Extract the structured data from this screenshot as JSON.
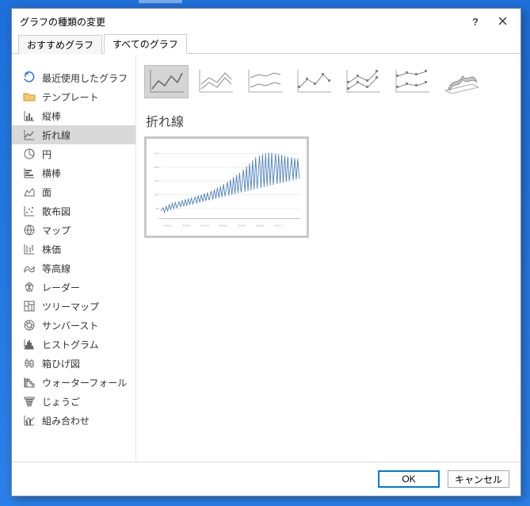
{
  "dialog": {
    "title": "グラフの種類の変更",
    "help_label": "?",
    "tabs": {
      "recommended": "おすすめグラフ",
      "all": "すべてのグラフ"
    }
  },
  "categories": [
    {
      "id": "recent",
      "label": "最近使用したグラフ"
    },
    {
      "id": "templates",
      "label": "テンプレート"
    },
    {
      "id": "column",
      "label": "縦棒"
    },
    {
      "id": "line",
      "label": "折れ線"
    },
    {
      "id": "pie",
      "label": "円"
    },
    {
      "id": "bar",
      "label": "横棒"
    },
    {
      "id": "area",
      "label": "面"
    },
    {
      "id": "scatter",
      "label": "散布図"
    },
    {
      "id": "map",
      "label": "マップ"
    },
    {
      "id": "stock",
      "label": "株価"
    },
    {
      "id": "surface",
      "label": "等高線"
    },
    {
      "id": "radar",
      "label": "レーダー"
    },
    {
      "id": "treemap",
      "label": "ツリーマップ"
    },
    {
      "id": "sunburst",
      "label": "サンバースト"
    },
    {
      "id": "histogram",
      "label": "ヒストグラム"
    },
    {
      "id": "boxwhisker",
      "label": "箱ひげ図"
    },
    {
      "id": "waterfall",
      "label": "ウォーターフォール"
    },
    {
      "id": "funnel",
      "label": "じょうご"
    },
    {
      "id": "combo",
      "label": "組み合わせ"
    }
  ],
  "selected_category_index": 3,
  "section_title": "折れ線",
  "buttons": {
    "ok": "OK",
    "cancel": "キャンセル"
  }
}
